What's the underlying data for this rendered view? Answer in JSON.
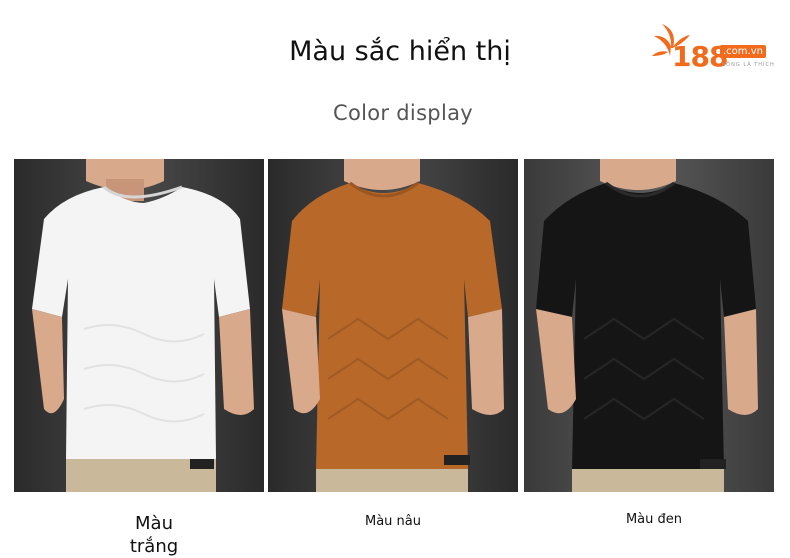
{
  "heading": {
    "title": "Màu sắc hiển thị",
    "subtitle": "Color display"
  },
  "logo": {
    "brand_number": "188",
    "domain": ".com.vn",
    "tagline": "SỐNG LÀ THÍCH",
    "color": "#f26b1d"
  },
  "products": [
    {
      "caption_line1": "Màu",
      "caption_line2": "trắng",
      "shirt_color": "#f4f4f4",
      "background": "#3a3a3a"
    },
    {
      "caption": "Màu nâu",
      "shirt_color": "#b8692a",
      "background": "#3a3a3a"
    },
    {
      "caption": "Màu đen",
      "shirt_color": "#151515",
      "background": "#4a4a4a"
    }
  ]
}
